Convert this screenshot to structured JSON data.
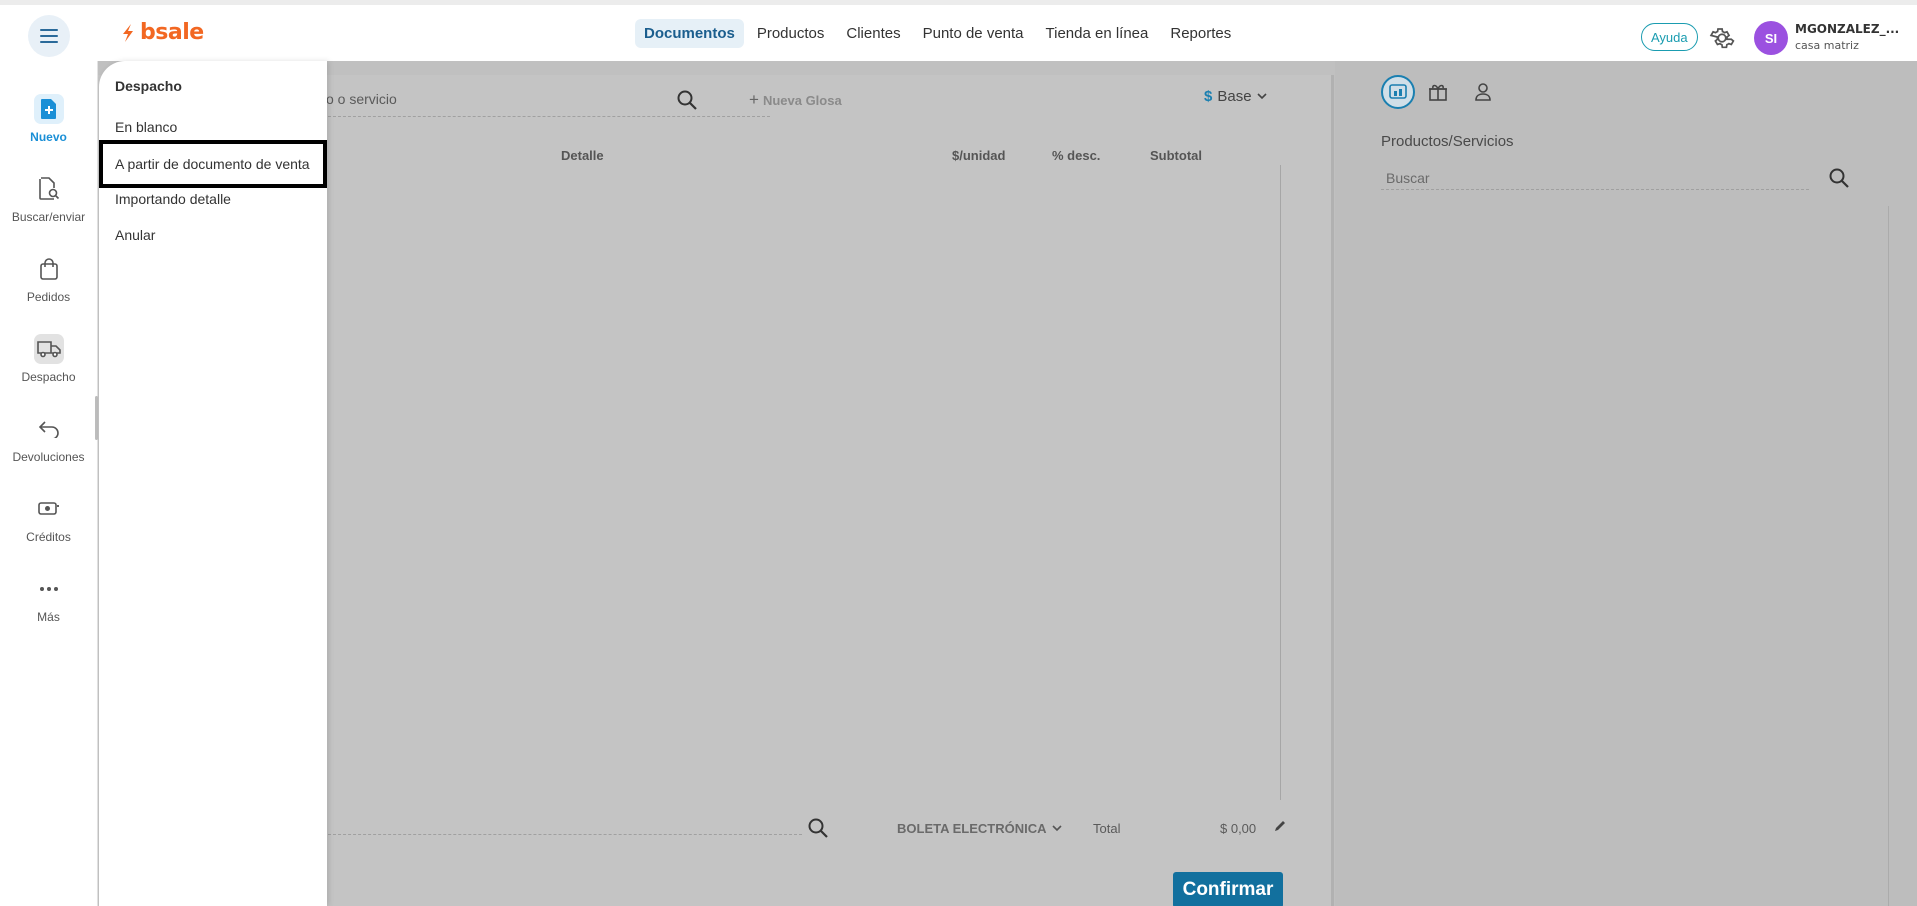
{
  "header": {
    "logo_text": "bsale",
    "nav": [
      "Documentos",
      "Productos",
      "Clientes",
      "Punto de venta",
      "Tienda en línea",
      "Reportes"
    ],
    "active_nav": "Documentos",
    "help_label": "Ayuda",
    "user": {
      "initials": "SI",
      "name": "MGONZALEZ_...",
      "branch": "casa matriz"
    }
  },
  "sidebar": {
    "items": [
      {
        "label": "Nuevo",
        "icon": "new-document-icon"
      },
      {
        "label": "Buscar/enviar",
        "icon": "search-document-icon"
      },
      {
        "label": "Pedidos",
        "icon": "bag-icon"
      },
      {
        "label": "Despacho",
        "icon": "truck-icon"
      },
      {
        "label": "Devoluciones",
        "icon": "return-arrow-icon"
      },
      {
        "label": "Créditos",
        "icon": "money-icon"
      },
      {
        "label": "Más",
        "icon": "more-dots-icon"
      }
    ]
  },
  "flyout": {
    "title": "Despacho",
    "items": [
      "En blanco",
      "A partir de documento de venta",
      "Importando detalle",
      "Anular"
    ],
    "selected": "A partir de documento de venta"
  },
  "document": {
    "search_placeholder_partial": "o o servicio",
    "new_glosa_label": "Nueva Glosa",
    "price_list_symbol": "$",
    "price_list_label": "Base",
    "columns": [
      "Detalle",
      "$/unidad",
      "% desc.",
      "Subtotal"
    ],
    "doc_type": "BOLETA ELECTRÓNICA",
    "total_label": "Total",
    "total_value": "$ 0,00",
    "confirm_label": "Confirmar"
  },
  "products_panel": {
    "title": "Productos/Servicios",
    "search_placeholder": "Buscar"
  },
  "colors": {
    "brand_orange": "#f26722",
    "active_blue": "#1a8fd6",
    "confirm_blue": "#12709e",
    "avatar_purple": "#9b51e0",
    "help_teal": "#1a9cb0",
    "overlay_gray": "#c0c0c0"
  }
}
